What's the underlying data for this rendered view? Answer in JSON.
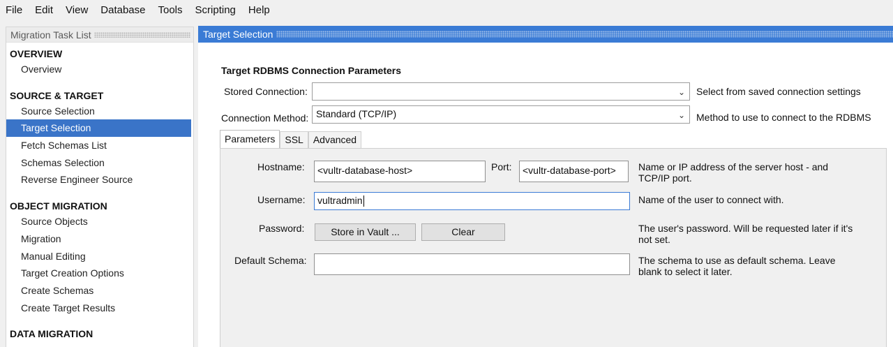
{
  "menu": [
    "File",
    "Edit",
    "View",
    "Database",
    "Tools",
    "Scripting",
    "Help"
  ],
  "sidebar": {
    "title": "Migration Task List",
    "sections": [
      {
        "title": "OVERVIEW",
        "items": [
          "Overview"
        ]
      },
      {
        "title": "SOURCE & TARGET",
        "items": [
          "Source Selection",
          "Target Selection",
          "Fetch Schemas List",
          "Schemas Selection",
          "Reverse Engineer Source"
        ]
      },
      {
        "title": "OBJECT MIGRATION",
        "items": [
          "Source Objects",
          "Migration",
          "Manual Editing",
          "Target Creation Options",
          "Create Schemas",
          "Create Target Results"
        ]
      },
      {
        "title": "DATA MIGRATION",
        "items": []
      }
    ],
    "selected": "Target Selection"
  },
  "main": {
    "header": "Target Selection",
    "group_title": "Target RDBMS Connection Parameters",
    "stored_connection": {
      "label": "Stored Connection:",
      "value": "",
      "hint": "Select from saved connection settings"
    },
    "connection_method": {
      "label": "Connection Method:",
      "value": "Standard (TCP/IP)",
      "hint": "Method to use to connect to the RDBMS"
    },
    "tabs": [
      "Parameters",
      "SSL",
      "Advanced"
    ],
    "active_tab": "Parameters",
    "params": {
      "hostname": {
        "label": "Hostname:",
        "value": "<vultr-database-host>"
      },
      "port": {
        "label": "Port:",
        "value": "<vultr-database-port>",
        "hint": "Name or IP address of the server host - and TCP/IP port."
      },
      "username": {
        "label": "Username:",
        "value": "vultradmin",
        "hint": "Name of the user to connect with."
      },
      "password": {
        "label": "Password:",
        "store_button": "Store in Vault ...",
        "clear_button": "Clear",
        "hint": "The user's password. Will be requested later if it's not set."
      },
      "default_schema": {
        "label": "Default Schema:",
        "value": "",
        "hint": "The schema to use as default schema. Leave blank to select it later."
      }
    }
  },
  "colors": {
    "accent": "#3a7bd5",
    "selected": "#3a74c8"
  },
  "icons": {
    "dropdown": "chevron-down-icon"
  }
}
